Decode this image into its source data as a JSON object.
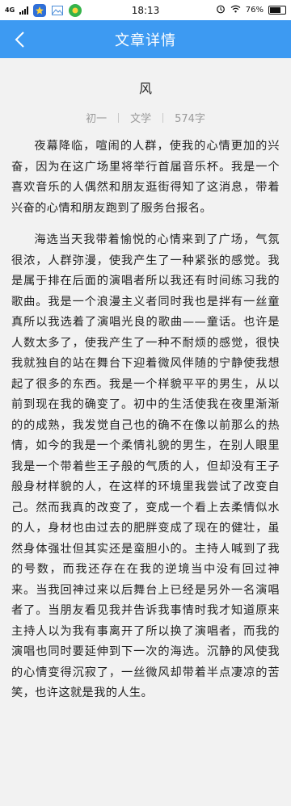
{
  "status_bar": {
    "network": "4G",
    "time": "18:13",
    "battery": "76%",
    "battery_level": 0.76
  },
  "nav": {
    "title": "文章详情"
  },
  "article": {
    "title": "风",
    "grade": "初一",
    "category": "文学",
    "word_count": "574字",
    "paragraphs": [
      "夜幕降临，喧闹的人群，使我的心情更加的兴奋，因为在这广场里将举行首届音乐杯。我是一个喜欢音乐的人偶然和朋友逛街得知了这消息，带着兴奋的心情和朋友跑到了服务台报名。",
      "海选当天我带着愉悦的心情来到了广场，气氛很浓，人群弥漫，使我产生了一种紧张的感觉。我是属于排在后面的演唱者所以我还有时间练习我的歌曲。我是一个浪漫主义者同时我也是拌有一丝童真所以我选着了演唱光良的歌曲——童话。也许是人数太多了，使我产生了一种不耐烦的感觉，很快我就独自的站在舞台下迎着微风伴随的宁静使我想起了很多的东西。我是一个样貌平平的男生，从以前到现在我的确变了。初中的生活使我在夜里渐渐的的成熟，我发觉自己也的确不在像以前那么的热情，如今的我是一个柔情礼貌的男生，在别人眼里我是一个带着些王子般的气质的人，但却没有王子般身材样貌的人，在这样的环境里我尝试了改变自己。然而我真的改变了，变成一个看上去柔情似水的人，身材也由过去的肥胖变成了现在的健壮，虽然身体强壮但其实还是蛮胆小的。主持人喊到了我的号数，而我还存在在我的逆境当中没有回过神来。当我回神过来以后舞台上已经是另外一名演唱者了。当朋友看见我并告诉我事情时我才知道原来主持人以为我有事离开了所以换了演唱者，而我的演唱也同时要延伸到下一次的海选。沉静的风使我的心情变得沉寂了，一丝微风却带着半点凄凉的苦笑，也许这就是我的人生。"
    ]
  },
  "colors": {
    "nav_bg": "#3d9af2",
    "page_bg": "#f2f2f2",
    "meta_text": "#9a9a9a"
  },
  "icons": [
    "signal-icon",
    "star-app-icon",
    "image-app-icon",
    "coin-app-icon",
    "alarm-icon",
    "wifi-icon",
    "battery-icon",
    "back-arrow-icon"
  ]
}
